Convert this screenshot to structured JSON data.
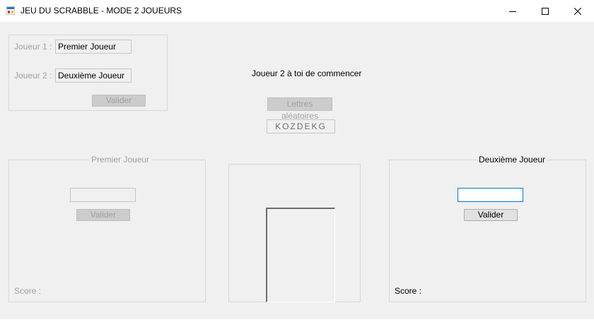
{
  "window": {
    "title": "JEU DU SCRABBLE - MODE 2 JOUEURS",
    "minimize_icon": "minimize-icon",
    "maximize_icon": "maximize-icon",
    "close_icon": "close-icon"
  },
  "setup": {
    "player1_label": "Joueur 1 :",
    "player1_value": "Premier Joueur",
    "player2_label": "Joueur 2 :",
    "player2_value": "Deuxième Joueur",
    "validate_label": "Valider"
  },
  "center": {
    "turn_message": "Joueur 2 à toi de commencer",
    "random_letters_button": "Lettres aléatoires",
    "letters": "KOZDEKG"
  },
  "player1_panel": {
    "title": "Premier Joueur",
    "word_value": "",
    "validate_label": "Valider",
    "score_label": "Score :"
  },
  "player2_panel": {
    "title": "Deuxième Joueur",
    "word_value": "",
    "validate_label": "Valider",
    "score_label": "Score :"
  },
  "colors": {
    "client_background": "#f0f0f0",
    "focus_border": "#0078d7",
    "disabled_text": "#a0a0a0"
  }
}
